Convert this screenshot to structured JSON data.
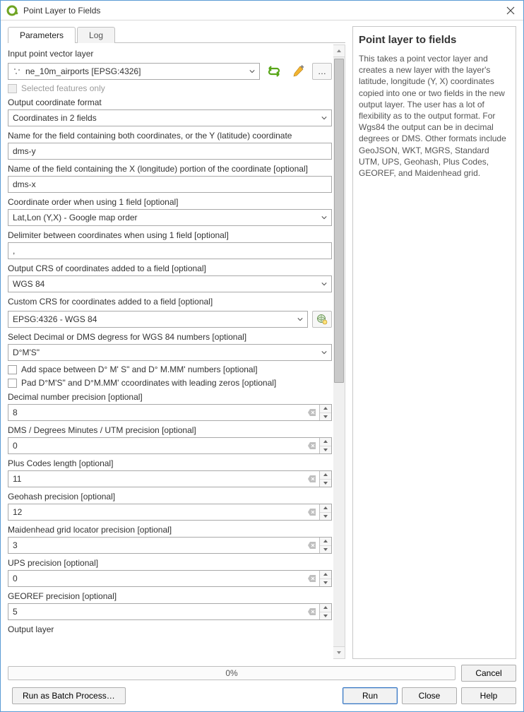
{
  "window": {
    "title": "Point Layer to Fields"
  },
  "tabs": {
    "parameters": "Parameters",
    "log": "Log"
  },
  "sidebar": {
    "heading": "Point layer to fields",
    "description": "This takes a point vector layer and creates a new layer with the layer's latitude, longitude (Y, X) coordinates copied into one or two fields in the new output layer. The user has a lot of flexibility as to the output format. For Wgs84 the output can be in decimal degrees or DMS. Other formats include GeoJSON, WKT, MGRS, Standard UTM, UPS, Geohash, Plus Codes, GEOREF, and Maidenhead grid."
  },
  "params": {
    "input_label": "Input point vector layer",
    "input_value": "ne_10m_airports [EPSG:4326]",
    "selected_only": "Selected features only",
    "out_fmt_label": "Output coordinate format",
    "out_fmt_value": "Coordinates in 2 fields",
    "yname_label": "Name for the field containing both coordinates, or the Y (latitude) coordinate",
    "yname_value": "dms-y",
    "xname_label": "Name of the field containing the X (longitude) portion of the coordinate [optional]",
    "xname_value": "dms-x",
    "order_label": "Coordinate order when using 1 field [optional]",
    "order_value": "Lat,Lon (Y,X) - Google map order",
    "delim_label": "Delimiter between coordinates when using 1 field [optional]",
    "delim_value": ",",
    "outcrs_label": "Output CRS of coordinates added to a field [optional]",
    "outcrs_value": "WGS 84",
    "customcrs_label": "Custom CRS for coordinates added to a field [optional]",
    "customcrs_value": "EPSG:4326 - WGS 84",
    "dmsdec_label": "Select Decimal or DMS degress for WGS 84 numbers [optional]",
    "dmsdec_value": "D°M'S\"",
    "chk_space": "Add space between D° M' S\" and D° M.MM' numbers [optional]",
    "chk_pad": "Pad D°M'S\" and D°M.MM' ccoordinates with leading zeros [optional]",
    "dec_prec_label": "Decimal number precision [optional]",
    "dec_prec_value": "8",
    "dms_prec_label": "DMS / Degrees Minutes / UTM precision [optional]",
    "dms_prec_value": "0",
    "plus_label": "Plus Codes length [optional]",
    "plus_value": "11",
    "geohash_label": "Geohash precision [optional]",
    "geohash_value": "12",
    "maiden_label": "Maidenhead grid locator precision [optional]",
    "maiden_value": "3",
    "ups_label": "UPS precision [optional]",
    "ups_value": "0",
    "georef_label": "GEOREF precision [optional]",
    "georef_value": "5",
    "output_layer_label": "Output layer"
  },
  "progress": {
    "text": "0%"
  },
  "buttons": {
    "cancel": "Cancel",
    "batch": "Run as Batch Process…",
    "run": "Run",
    "close": "Close",
    "help": "Help"
  }
}
